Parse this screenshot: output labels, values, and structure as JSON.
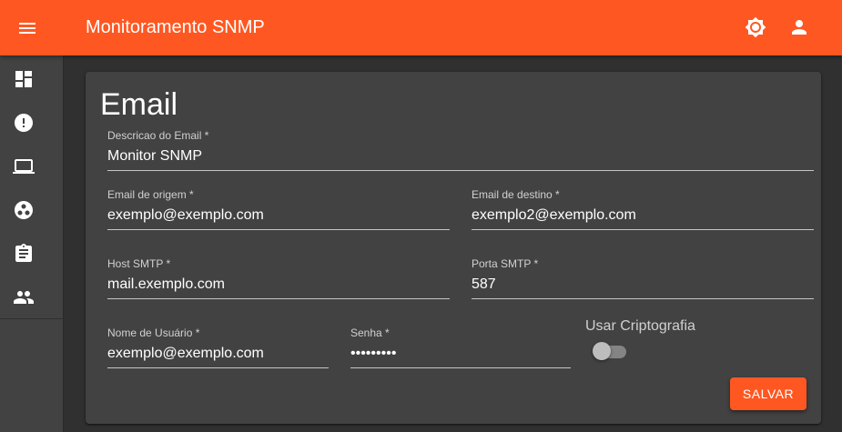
{
  "app": {
    "title": "Monitoramento SNMP",
    "menu_icon": "menu-icon",
    "actions": [
      {
        "icon": "brightness-icon"
      },
      {
        "icon": "account-icon"
      }
    ]
  },
  "sidebar": {
    "items": [
      {
        "icon": "dashboard-icon"
      },
      {
        "icon": "alert-circle-icon"
      },
      {
        "icon": "laptop-icon"
      },
      {
        "icon": "group-work-icon"
      },
      {
        "icon": "assignment-icon"
      },
      {
        "icon": "people-icon"
      }
    ]
  },
  "form": {
    "title": "Email",
    "fields": {
      "description": {
        "label": "Descricao do Email *",
        "value": "Monitor SNMP"
      },
      "origin_email": {
        "label": "Email de origem *",
        "value": "exemplo@exemplo.com"
      },
      "destination_email": {
        "label": "Email de destino *",
        "value": "exemplo2@exemplo.com"
      },
      "smtp_host": {
        "label": "Host SMTP *",
        "value": "mail.exemplo.com"
      },
      "smtp_port": {
        "label": "Porta SMTP *",
        "value": "587"
      },
      "username": {
        "label": "Nome de Usuário *",
        "value": "exemplo@exemplo.com"
      },
      "password": {
        "label": "Senha *",
        "value": "secret123"
      }
    },
    "encryption": {
      "label": "Usar Criptografia",
      "enabled": false
    },
    "save_label": "SALVAR"
  },
  "colors": {
    "primary": "#ff5722",
    "background": "#303030",
    "surface": "#424242",
    "text": "#ffffff"
  }
}
